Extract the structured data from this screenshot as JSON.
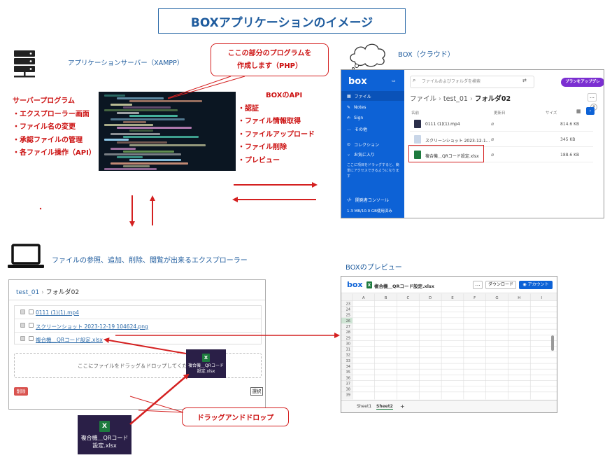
{
  "title": "BOXアプリケーションのイメージ",
  "server": {
    "label": "アプリケーションサーバー（XAMPP）",
    "program_title": "サーバープログラム",
    "program_items": [
      "・エクスプローラー画面",
      "・ファイル名の変更",
      "・承認ファイルの管理",
      "・各ファイル操作（API）"
    ],
    "icon": "server-icon"
  },
  "callout_php": {
    "line1": "ここの部分のプログラムを",
    "line2": "作成します（PHP）"
  },
  "api": {
    "title": "BOXのAPI",
    "items": [
      "・認証",
      "・ファイル情報取得",
      "・ファイルアップロード",
      "・ファイル削除",
      "・プレビュー"
    ]
  },
  "cloud": {
    "label": "BOX（クラウド）",
    "icon": "cloud-icon"
  },
  "box_app": {
    "logo": "box",
    "sidebar": {
      "files": "ファイル",
      "notes": "Notes",
      "sign": "Sign",
      "other": "その他",
      "collection": "コレクション",
      "favorites": "お気に入り",
      "favorites_hint": "ここに項目をドラッグすると、簡単にアクセスできるようになります",
      "dev_console": "開発者コンソール",
      "storage": "1.3 MB/10.0 GB使用済み"
    },
    "search_placeholder": "ファイルおよびフォルダを検索",
    "upgrade": "プランをアップグレ",
    "breadcrumb": {
      "root": "ファイル",
      "folder1": "test_01",
      "folder2": "フォルダ02"
    },
    "columns": {
      "name": "名前",
      "updated": "更新日",
      "size": "サイズ"
    },
    "files": [
      {
        "name": "0111 (1)(1).mp4",
        "size": "814.6 KB"
      },
      {
        "name": "スクリーンショット 2023-12-1...",
        "size": "345 KB"
      },
      {
        "name": "複合機＿QRコード設定.xlsx",
        "size": "188.6 KB"
      }
    ]
  },
  "explorer": {
    "label": "ファイルの参照、追加、削除、閲覧が出来るエクスプローラー",
    "icon": "laptop-icon",
    "breadcrumb": {
      "folder1": "test_01",
      "sep": "›",
      "folder2": "フォルダ02"
    },
    "files": [
      "0111 (1)(1).mp4",
      "スクリーンショット 2023-12-19 104624.png",
      "複合機＿QRコード設定.xlsx"
    ],
    "drop_text": "ここにファイルをドラッグ＆ドロップしてください",
    "delete_label": "削除",
    "select_label": "選択"
  },
  "dragged_file": {
    "line1": "複合機＿QRコード",
    "line2": "設定.xlsx"
  },
  "source_file": {
    "line1": "複合機＿QRコード",
    "line2": "設定.xlsx"
  },
  "callout_dnd": "ドラッグアンドドロップ",
  "preview": {
    "label": "BOXのプレビュー",
    "logo": "box",
    "filename": "複合機＿QRコード設定.xlsx",
    "more": "…",
    "download": "ダウンロード",
    "account": "アカウント",
    "columns": [
      "A",
      "B",
      "C",
      "D",
      "E",
      "F",
      "G",
      "H",
      "I"
    ],
    "rows": [
      "23",
      "24",
      "25",
      "26",
      "27",
      "28",
      "29",
      "30",
      "31",
      "32",
      "33",
      "34",
      "35",
      "36",
      "37",
      "38",
      "39"
    ],
    "sheets": [
      "Sheet1",
      "Sheet2"
    ]
  },
  "colors": {
    "accent_red": "#d42020",
    "text_blue": "#1f5c9e",
    "box_blue": "#0d62d6",
    "excel_green": "#1d7a3e"
  }
}
